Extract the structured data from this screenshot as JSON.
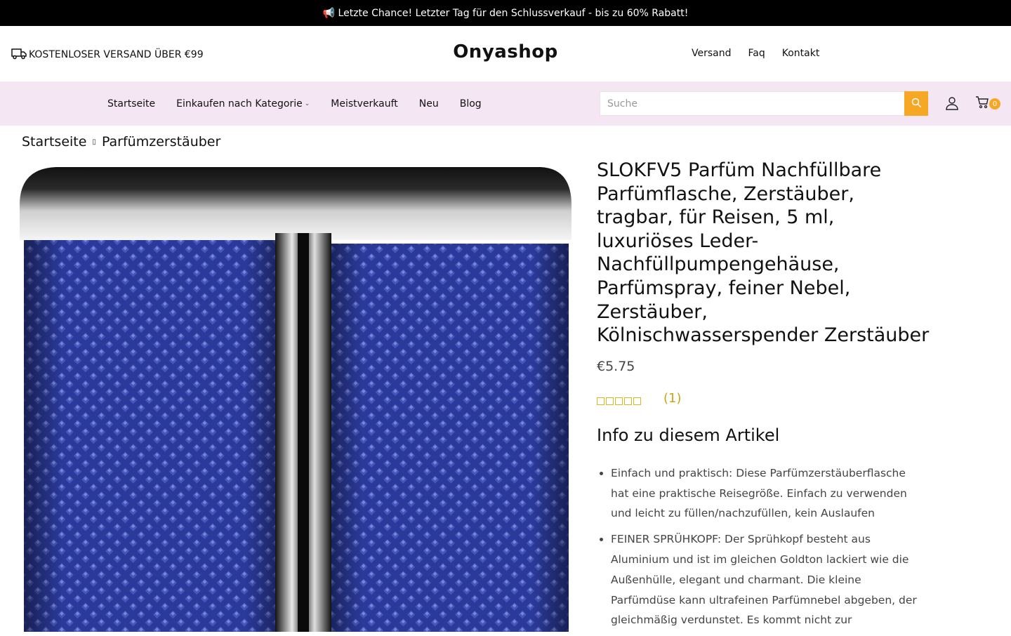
{
  "topbar": {
    "text": "📢 Letzte Chance! Letzter Tag für den Schlussverkauf - bis zu 60% Rabatt!"
  },
  "header": {
    "shipping_text": "KOSTENLOSER VERSAND ÜBER €99",
    "logo": "Onyashop",
    "links": [
      "Versand",
      "Faq",
      "Kontakt"
    ]
  },
  "nav": {
    "items": [
      "Startseite",
      "Einkaufen nach Kategorie",
      "Meistverkauft",
      "Neu",
      "Blog"
    ],
    "search_placeholder": "Suche",
    "cart_count": "0"
  },
  "breadcrumb": {
    "home": "Startseite",
    "current": "Parfümzerstäuber"
  },
  "product": {
    "title": "SLOKFV5 Parfüm Nachfüllbare Parfümflasche, Zerstäuber, tragbar, für Reisen, 5 ml, luxuriöses Leder-Nachfüllpumpengehäuse, Parfümspray, feiner Nebel, Zerstäuber, Kölnischwasserspender Zerstäuber",
    "price": "€5.75",
    "rating_count": "(1)",
    "info_heading": "Info zu diesem Artikel",
    "bullets": [
      "Einfach und praktisch: Diese Parfümzerstäuberflasche hat eine praktische Reisegröße. Einfach zu verwenden und leicht zu füllen/nachzufüllen, kein Auslaufen",
      "FEINER SPRÜHKOPF: Der Sprühkopf besteht aus Aluminium und ist im gleichen Goldton lackiert wie die Außenhülle, elegant und charmant. Die kleine Parfümdüse kann ultrafeinen Parfümnebel abgeben, der gleichmäßig verdunstet. Es kommt nicht zur"
    ]
  },
  "colors": {
    "accent": "#f6a723",
    "nav_bg": "#f5e6f3",
    "bottle_blue": "#2b3a9a"
  }
}
